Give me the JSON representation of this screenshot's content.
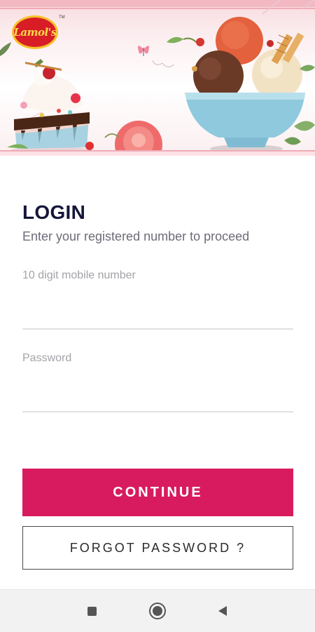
{
  "brand": {
    "logo_text": "Lamol's",
    "tm": "TM"
  },
  "banner": {
    "image": "ice-cream-dessert-banner"
  },
  "login": {
    "title": "LOGIN",
    "subtitle": "Enter your registered number to proceed",
    "mobile_placeholder": "10 digit mobile number",
    "mobile_value": "",
    "password_placeholder": "Password",
    "password_value": ""
  },
  "buttons": {
    "continue": "CONTINUE",
    "forgot": "FORGOT PASSWORD ?"
  },
  "colors": {
    "primary": "#d81b5e",
    "title": "#16163a",
    "logo_red": "#d81d26",
    "logo_yellow": "#f6c22b"
  },
  "navbar": {
    "icons": [
      "recents-square-icon",
      "home-circle-icon",
      "back-triangle-icon"
    ]
  }
}
